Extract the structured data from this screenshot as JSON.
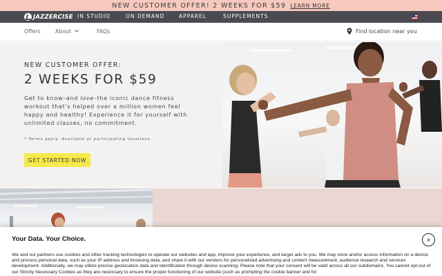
{
  "promo": {
    "text": "NEW CUSTOMER OFFER! 2 WEEKS FOR $59",
    "link": "LEARN MORE"
  },
  "nav": {
    "brand": "JAZZERCISE",
    "links": [
      "IN STUDIO",
      "ON DEMAND",
      "APPAREL",
      "SUPPLEMENTS"
    ],
    "flag_icon": "us-flag-icon"
  },
  "subnav": {
    "items": [
      "Offers",
      "About",
      "FAQs"
    ],
    "location": "Find location near you"
  },
  "hero": {
    "eyebrow": "NEW CUSTOMER OFFER:",
    "headline": "2 WEEKS FOR $59",
    "body_before": "Get to know–and ",
    "body_emphasis": "love",
    "body_after": "–the iconic dance fitness workout that's helped over a million women feel happy and healthy! Experience it for yourself with unlimited classes, no commitment.",
    "terms": "* Terms apply. Available at participating locations.",
    "cta": "GET STARTED NOW"
  },
  "cookie": {
    "title": "Your Data. Your Choice.",
    "text": "We and our partners use cookies and other tracking technologies to operate our websites and app, improve your experience, and target ads to you. We may store and/or access information on a device and process personal data, such as your IP address and browsing data, and share it with our vendors for personalized advertising and content measurement, audience research and services development. Additionally, we may utilize precise geolocation data and identification through device scanning. Please note that your consent will be valid across all our subdomains. You cannot opt-out of our Strictly Necessary Cookies as they are necessary to ensure the proper functioning of our website (such as prompting the cookie banner and for",
    "close": "x"
  },
  "colors": {
    "promo_bg": "#f6c9bd",
    "nav_bg": "#4a4a50",
    "cta_bg": "#f5e94c",
    "lower_panel": "#ead7d1"
  }
}
